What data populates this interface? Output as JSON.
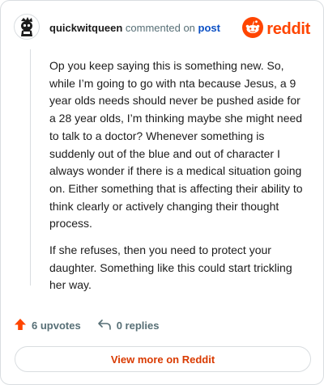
{
  "comment": {
    "username": "quickwitqueen",
    "action_text": "commented on",
    "post_link": "post",
    "paragraphs": [
      "Op you keep saying this is something new. So, while I’m going to go with nta because Jesus, a 9 year olds needs should never be pushed aside for a 28 year olds, I’m thinking maybe she might need to talk to a doctor? Whenever something is suddenly out of the blue and out of character I always wonder if there is a medical situation going on. Either something that is affecting their ability to think clearly or actively changing their thought process.",
      "If she refuses, then you need to protect your daughter. Something like this could start trickling her way."
    ]
  },
  "brand": {
    "name": "reddit",
    "color": "#ff4500"
  },
  "actions": {
    "upvotes": "6 upvotes",
    "replies": "0 replies"
  },
  "cta": {
    "label": "View more on Reddit",
    "color": "#d93a00"
  },
  "icons": {
    "avatar": "snoo-avatar-icon",
    "logo": "reddit-logo-icon",
    "upvote": "upvote-arrow-icon",
    "reply": "reply-arrow-icon"
  }
}
